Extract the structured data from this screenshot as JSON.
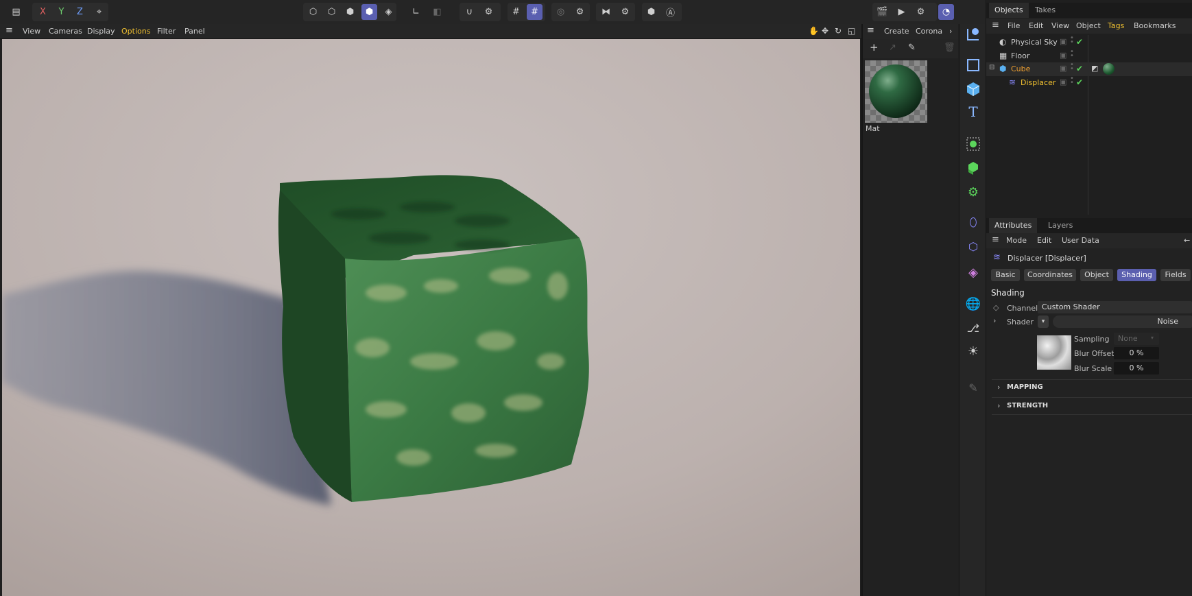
{
  "viewport_menu": {
    "view": "View",
    "cameras": "Cameras",
    "display": "Display",
    "options": "Options",
    "filter": "Filter",
    "panel": "Panel"
  },
  "toolbar": {
    "x": "X",
    "y": "Y",
    "z": "Z"
  },
  "material_panel": {
    "create": "Create",
    "corona": "Corona",
    "material_name": "Mat"
  },
  "objects_panel": {
    "tabs": [
      "Objects",
      "Takes"
    ],
    "menu": [
      "File",
      "Edit",
      "View",
      "Object",
      "Tags",
      "Bookmarks"
    ],
    "items": [
      {
        "name": "Physical Sky",
        "icon": "sky-icon",
        "color": "#cfcfcf"
      },
      {
        "name": "Floor",
        "icon": "floor-icon",
        "color": "#cfcfcf"
      },
      {
        "name": "Cube",
        "icon": "cube-icon",
        "color": "#f0a030"
      },
      {
        "name": "Displacer",
        "icon": "displacer-icon",
        "color": "#f0c030"
      }
    ]
  },
  "attributes_panel": {
    "tabs": [
      "Attributes",
      "Layers"
    ],
    "menu": [
      "Mode",
      "Edit",
      "User Data"
    ],
    "object_title": "Displacer [Displacer]",
    "section_tabs": [
      "Basic",
      "Coordinates",
      "Object",
      "Shading",
      "Fields"
    ],
    "active_section": "Shading",
    "section_title": "Shading",
    "channel_label": "Channel",
    "channel_value": "Custom Shader",
    "shader_label": "Shader",
    "shader_value": "Noise",
    "sampling_label": "Sampling",
    "sampling_value": "None",
    "blur_offset_label": "Blur Offset",
    "blur_offset_value": "0 %",
    "blur_scale_label": "Blur Scale",
    "blur_scale_value": "0 %",
    "groups": [
      "MAPPING",
      "STRENGTH"
    ]
  },
  "colors": {
    "accent": "#5b5faf",
    "highlight_text": "#f0c030",
    "check": "#5cd65c"
  }
}
